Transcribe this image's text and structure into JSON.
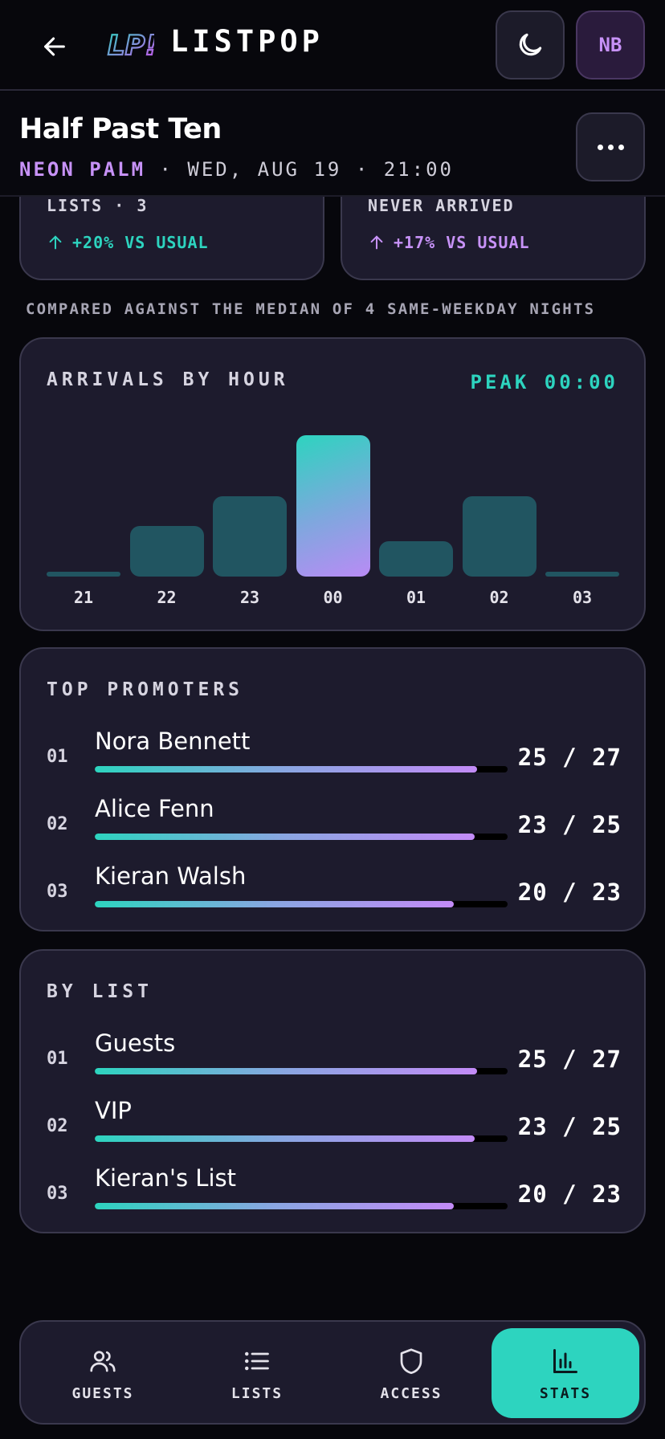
{
  "app": {
    "brand": "LISTPOP",
    "logo_text": "LP!",
    "avatar_initials": "NB"
  },
  "event": {
    "title": "Half Past Ten",
    "venue": "NEON PALM",
    "date": "WED, AUG 19",
    "time": "21:00",
    "separator": "·"
  },
  "stats": [
    {
      "label": "LISTS · 3",
      "delta": "+20% VS USUAL",
      "direction": "up",
      "color": "#2dd4bf"
    },
    {
      "label": "NEVER ARRIVED",
      "delta": "+17% VS USUAL",
      "direction": "up",
      "color": "#c792f7"
    }
  ],
  "compare_note": "COMPARED AGAINST THE MEDIAN OF 4 SAME-WEEKDAY NIGHTS",
  "arrivals": {
    "title": "ARRIVALS BY HOUR",
    "peak_label": "PEAK 00:00"
  },
  "chart_data": {
    "type": "bar",
    "title": "ARRIVALS BY HOUR",
    "categories": [
      "21",
      "22",
      "23",
      "00",
      "01",
      "02",
      "03"
    ],
    "values": [
      0.03,
      0.36,
      0.57,
      1.0,
      0.25,
      0.57,
      0.03
    ],
    "ylim": [
      0,
      1
    ],
    "highlight": "00",
    "grid": false,
    "colors": {
      "bar": "#215561",
      "peak_start": "#2dd4bf",
      "peak_end": "#b98bf5"
    }
  },
  "top_promoters": {
    "title": "TOP PROMOTERS",
    "rows": [
      {
        "rank": "01",
        "name": "Nora Bennett",
        "count": "25 / 27",
        "fill": 0.926
      },
      {
        "rank": "02",
        "name": "Alice Fenn",
        "count": "23 / 25",
        "fill": 0.92
      },
      {
        "rank": "03",
        "name": "Kieran Walsh",
        "count": "20 / 23",
        "fill": 0.87
      }
    ]
  },
  "by_list": {
    "title": "BY LIST",
    "rows": [
      {
        "rank": "01",
        "name": "Guests",
        "count": "25 / 27",
        "fill": 0.926
      },
      {
        "rank": "02",
        "name": "VIP",
        "count": "23 / 25",
        "fill": 0.92
      },
      {
        "rank": "03",
        "name": "Kieran's List",
        "count": "20 / 23",
        "fill": 0.87
      }
    ]
  },
  "nav": {
    "items": [
      {
        "label": "GUESTS",
        "icon": "users-icon",
        "active": false
      },
      {
        "label": "LISTS",
        "icon": "list-icon",
        "active": false
      },
      {
        "label": "ACCESS",
        "icon": "shield-icon",
        "active": false
      },
      {
        "label": "STATS",
        "icon": "bar-chart-icon",
        "active": true
      }
    ]
  },
  "colors": {
    "accent_teal": "#2dd4bf",
    "accent_purple": "#c792f7",
    "background": "#07070c",
    "card": "#1d1b2d"
  }
}
